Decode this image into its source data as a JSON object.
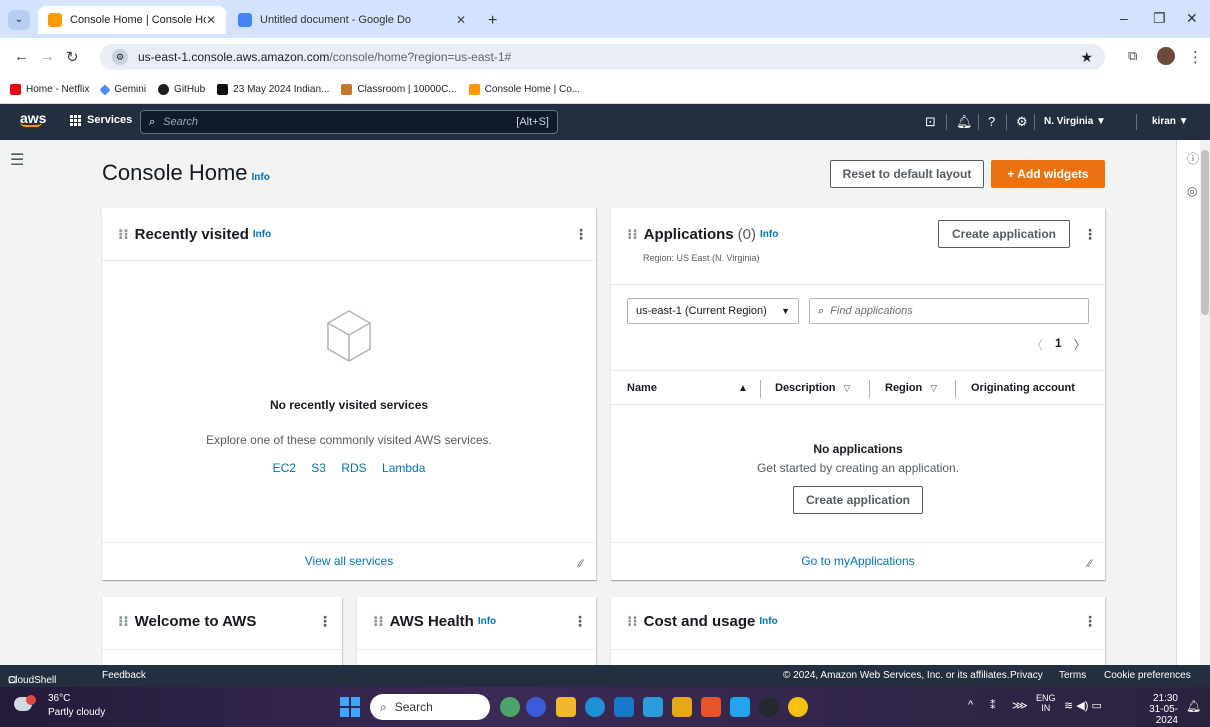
{
  "browser": {
    "tabs": [
      {
        "title": "Console Home | Console Home",
        "close": "✕"
      },
      {
        "title": "Untitled document - Google Do",
        "close": "✕"
      }
    ],
    "new_tab": "+",
    "url_host": "us-east-1.console.aws.amazon.com",
    "url_path": "/console/home?region=us-east-1#",
    "bookmarks": [
      {
        "label": "Home - Netflix",
        "color": "#e50914"
      },
      {
        "label": "Gemini",
        "color": "#4f8df5"
      },
      {
        "label": "GitHub",
        "color": "#1f1f1f"
      },
      {
        "label": "23 May 2024 Indian...",
        "color": "#111111"
      },
      {
        "label": "Classroom | 10000C...",
        "color": "#c2782c"
      },
      {
        "label": "Console Home | Co...",
        "color": "#ff9900"
      }
    ]
  },
  "aws_nav": {
    "logo": "aws",
    "services": "Services",
    "search_placeholder": "Search",
    "search_shortcut": "[Alt+S]",
    "region": "N. Virginia ▼",
    "user": "kiran ▼"
  },
  "page": {
    "title": "Console Home",
    "title_info": "Info",
    "reset_button": "Reset to default layout",
    "add_widgets_button": "+ Add widgets"
  },
  "recently_visited": {
    "title": "Recently visited",
    "info": "Info",
    "empty_title": "No recently visited services",
    "empty_desc": "Explore one of these commonly visited AWS services.",
    "services": [
      "EC2",
      "S3",
      "RDS",
      "Lambda"
    ],
    "footer_link": "View all services"
  },
  "applications": {
    "title": "Applications",
    "count": "(0)",
    "info": "Info",
    "region_label": "Region: US East (N. Virginia)",
    "create_button": "Create application",
    "region_select": "us-east-1 (Current Region)",
    "find_placeholder": "Find applications",
    "page": "1",
    "columns": [
      "Name",
      "Description",
      "Region",
      "Originating account"
    ],
    "empty_title": "No applications",
    "empty_desc": "Get started by creating an application.",
    "empty_button": "Create application",
    "footer_link": "Go to myApplications"
  },
  "welcome": {
    "title": "Welcome to AWS"
  },
  "health": {
    "title": "AWS Health",
    "info": "Info"
  },
  "cost": {
    "title": "Cost and usage",
    "info": "Info"
  },
  "footer": {
    "cloudshell": "CloudShell",
    "feedback": "Feedback",
    "copyright": "© 2024, Amazon Web Services, Inc. or its affiliates.",
    "privacy": "Privacy",
    "terms": "Terms",
    "cookies": "Cookie preferences"
  },
  "taskbar": {
    "temp": "36°C",
    "weather": "Partly cloudy",
    "search": "Search",
    "lang1": "ENG",
    "lang2": "IN",
    "time": "21:30",
    "date": "31-05-2024"
  }
}
